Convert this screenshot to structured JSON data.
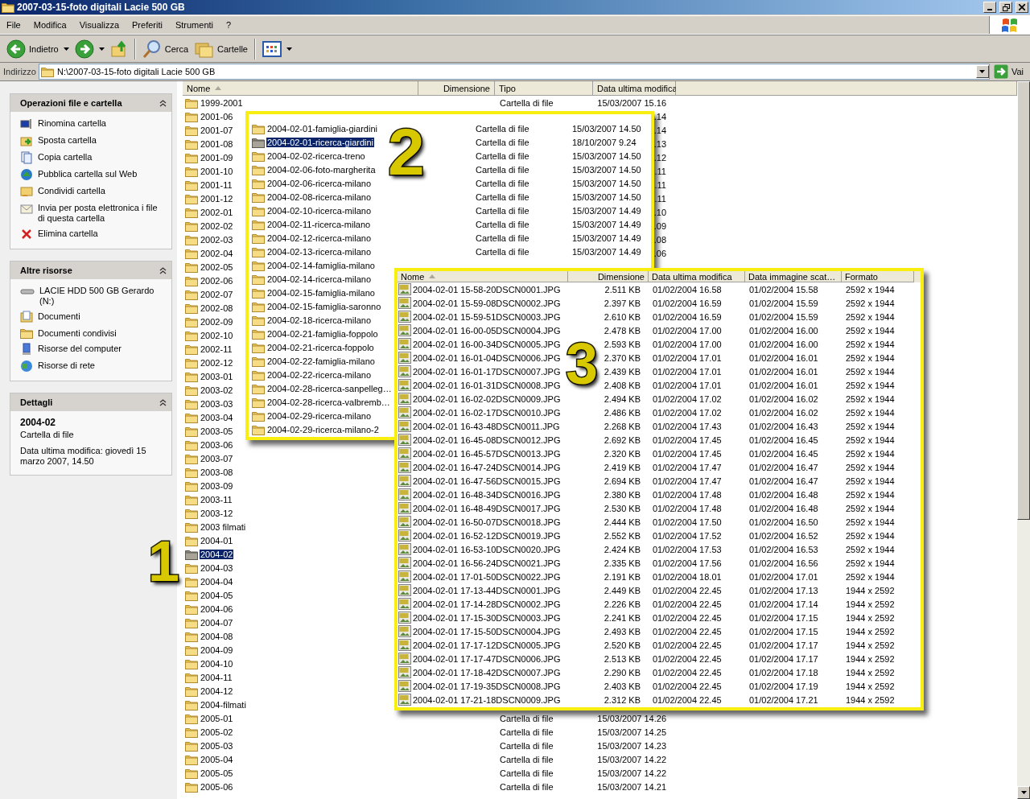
{
  "window": {
    "title": "2007-03-15-foto digitali Lacie 500 GB"
  },
  "menu": [
    "File",
    "Modifica",
    "Visualizza",
    "Preferiti",
    "Strumenti",
    "?"
  ],
  "toolbar": {
    "back": "Indietro",
    "search": "Cerca",
    "folders": "Cartelle"
  },
  "address": {
    "label": "Indirizzo",
    "value": "N:\\2007-03-15-foto digitali Lacie 500 GB",
    "go": "Vai"
  },
  "task_pane": [
    {
      "title": "Operazioni file e cartella",
      "expanded": true,
      "kind": "links",
      "items": [
        "Rinomina cartella",
        "Sposta cartella",
        "Copia cartella",
        "Pubblica cartella sul Web",
        "Condividi cartella",
        "Invia per posta elettronica i file di questa cartella",
        "Elimina cartella"
      ]
    },
    {
      "title": "Altre risorse",
      "expanded": true,
      "kind": "links",
      "items": [
        "LACIE HDD 500 GB Gerardo (N:)",
        "Documenti",
        "Documenti condivisi",
        "Risorse del computer",
        "Risorse di rete"
      ]
    },
    {
      "title": "Dettagli",
      "expanded": true,
      "kind": "details",
      "items": [
        "2004-02",
        "Cartella di file",
        "Data ultima modifica: giovedì 15 marzo 2007, 14.50"
      ]
    }
  ],
  "file_list": {
    "columns": [
      {
        "label": "Nome",
        "sorted": true
      },
      {
        "label": "Dimensione"
      },
      {
        "label": "Tipo"
      },
      {
        "label": "Data ultima modifica"
      }
    ],
    "rows": [
      {
        "name": "1999-2001",
        "type": "Cartella di file",
        "modified": "15/03/2007 15.16",
        "selected": false
      },
      {
        "name": "2001-06",
        "modified": ".14",
        "selected": false
      },
      {
        "name": "2001-07",
        "modified": ".14",
        "selected": false
      },
      {
        "name": "2001-08",
        "modified": ".13",
        "selected": false
      },
      {
        "name": "2001-09",
        "modified": ".12",
        "selected": false
      },
      {
        "name": "2001-10",
        "modified": ".11",
        "selected": false
      },
      {
        "name": "2001-11",
        "modified": ".11",
        "selected": false
      },
      {
        "name": "2001-12",
        "modified": ".11",
        "selected": false
      },
      {
        "name": "2002-01",
        "modified": ".10",
        "selected": false
      },
      {
        "name": "2002-02",
        "modified": ".09",
        "selected": false
      },
      {
        "name": "2002-03",
        "modified": ".08",
        "selected": false
      },
      {
        "name": "2002-04",
        "modified": ".06",
        "selected": false
      },
      {
        "name": "2002-05",
        "selected": false
      },
      {
        "name": "2002-06",
        "selected": false
      },
      {
        "name": "2002-07",
        "selected": false
      },
      {
        "name": "2002-08",
        "selected": false
      },
      {
        "name": "2002-09",
        "selected": false
      },
      {
        "name": "2002-10",
        "selected": false
      },
      {
        "name": "2002-11",
        "selected": false
      },
      {
        "name": "2002-12",
        "selected": false
      },
      {
        "name": "2003-01",
        "selected": false
      },
      {
        "name": "2003-02",
        "selected": false
      },
      {
        "name": "2003-03",
        "selected": false
      },
      {
        "name": "2003-04",
        "selected": false
      },
      {
        "name": "2003-05",
        "selected": false
      },
      {
        "name": "2003-06",
        "selected": false
      },
      {
        "name": "2003-07",
        "selected": false
      },
      {
        "name": "2003-08",
        "selected": false
      },
      {
        "name": "2003-09",
        "selected": false
      },
      {
        "name": "2003-11",
        "selected": false
      },
      {
        "name": "2003-12",
        "selected": false
      },
      {
        "name": "2003 filmati",
        "selected": false
      },
      {
        "name": "2004-01",
        "selected": false
      },
      {
        "name": "2004-02",
        "selected": true
      },
      {
        "name": "2004-03",
        "selected": false
      },
      {
        "name": "2004-04",
        "selected": false
      },
      {
        "name": "2004-05",
        "selected": false
      },
      {
        "name": "2004-06",
        "selected": false
      },
      {
        "name": "2004-07",
        "selected": false
      },
      {
        "name": "2004-08",
        "selected": false
      },
      {
        "name": "2004-09",
        "selected": false
      },
      {
        "name": "2004-10",
        "selected": false
      },
      {
        "name": "2004-11",
        "selected": false
      },
      {
        "name": "2004-12",
        "selected": false
      },
      {
        "name": "2004-filmati",
        "selected": false
      },
      {
        "name": "2005-01",
        "type": "Cartella di file",
        "modified": "15/03/2007 14.26",
        "selected": false
      },
      {
        "name": "2005-02",
        "type": "Cartella di file",
        "modified": "15/03/2007 14.25",
        "selected": false
      },
      {
        "name": "2005-03",
        "type": "Cartella di file",
        "modified": "15/03/2007 14.23",
        "selected": false
      },
      {
        "name": "2005-04",
        "type": "Cartella di file",
        "modified": "15/03/2007 14.22",
        "selected": false
      },
      {
        "name": "2005-05",
        "type": "Cartella di file",
        "modified": "15/03/2007 14.22",
        "selected": false
      },
      {
        "name": "2005-06",
        "type": "Cartella di file",
        "modified": "15/03/2007 14.21",
        "selected": false
      }
    ]
  },
  "subfolder_popup": {
    "rows": [
      {
        "name": "2004-02-01-famiglia-giardini",
        "type": "Cartella di file",
        "modified": "15/03/2007 14.50",
        "selected": false
      },
      {
        "name": "2004-02-01-ricerca-giardini",
        "type": "Cartella di file",
        "modified": "18/10/2007 9.24",
        "selected": true
      },
      {
        "name": "2004-02-02-ricerca-treno",
        "type": "Cartella di file",
        "modified": "15/03/2007 14.50",
        "selected": false
      },
      {
        "name": "2004-02-06-foto-margherita",
        "type": "Cartella di file",
        "modified": "15/03/2007 14.50",
        "selected": false
      },
      {
        "name": "2004-02-06-ricerca-milano",
        "type": "Cartella di file",
        "modified": "15/03/2007 14.50",
        "selected": false
      },
      {
        "name": "2004-02-08-ricerca-milano",
        "type": "Cartella di file",
        "modified": "15/03/2007 14.50",
        "selected": false
      },
      {
        "name": "2004-02-10-ricerca-milano",
        "type": "Cartella di file",
        "modified": "15/03/2007 14.49",
        "selected": false
      },
      {
        "name": "2004-02-11-ricerca-milano",
        "type": "Cartella di file",
        "modified": "15/03/2007 14.49",
        "selected": false
      },
      {
        "name": "2004-02-12-ricerca-milano",
        "type": "Cartella di file",
        "modified": "15/03/2007 14.49",
        "selected": false
      },
      {
        "name": "2004-02-13-ricerca-milano",
        "type": "Cartella di file",
        "modified": "15/03/2007 14.49",
        "selected": false
      },
      {
        "name": "2004-02-14-famiglia-milano",
        "selected": false
      },
      {
        "name": "2004-02-14-ricerca-milano",
        "selected": false
      },
      {
        "name": "2004-02-15-famiglia-milano",
        "selected": false
      },
      {
        "name": "2004-02-15-famiglia-saronno",
        "selected": false
      },
      {
        "name": "2004-02-18-ricerca-milano",
        "selected": false
      },
      {
        "name": "2004-02-21-famiglia-foppolo",
        "selected": false
      },
      {
        "name": "2004-02-21-ricerca-foppolo",
        "selected": false
      },
      {
        "name": "2004-02-22-famiglia-milano",
        "selected": false
      },
      {
        "name": "2004-02-22-ricerca-milano",
        "selected": false
      },
      {
        "name": "2004-02-28-ricerca-sanpelleg…",
        "selected": false
      },
      {
        "name": "2004-02-28-ricerca-valbremb…",
        "selected": false
      },
      {
        "name": "2004-02-29-ricerca-milano",
        "selected": false
      },
      {
        "name": "2004-02-29-ricerca-milano-2",
        "selected": false
      }
    ]
  },
  "photo_popup": {
    "columns": [
      {
        "label": "Nome",
        "sorted": true
      },
      {
        "label": "Dimensione"
      },
      {
        "label": "Data ultima modifica"
      },
      {
        "label": "Data immagine scat…"
      },
      {
        "label": "Formato"
      }
    ],
    "rows": [
      [
        "2004-02-01 15-58-20DSCN0001.JPG",
        "2.511 KB",
        "01/02/2004 16.58",
        "01/02/2004 15.58",
        "2592 x 1944"
      ],
      [
        "2004-02-01 15-59-08DSCN0002.JPG",
        "2.397 KB",
        "01/02/2004 16.59",
        "01/02/2004 15.59",
        "2592 x 1944"
      ],
      [
        "2004-02-01 15-59-51DSCN0003.JPG",
        "2.610 KB",
        "01/02/2004 16.59",
        "01/02/2004 15.59",
        "2592 x 1944"
      ],
      [
        "2004-02-01 16-00-05DSCN0004.JPG",
        "2.478 KB",
        "01/02/2004 17.00",
        "01/02/2004 16.00",
        "2592 x 1944"
      ],
      [
        "2004-02-01 16-00-34DSCN0005.JPG",
        "2.593 KB",
        "01/02/2004 17.00",
        "01/02/2004 16.00",
        "2592 x 1944"
      ],
      [
        "2004-02-01 16-01-04DSCN0006.JPG",
        "2.370 KB",
        "01/02/2004 17.01",
        "01/02/2004 16.01",
        "2592 x 1944"
      ],
      [
        "2004-02-01 16-01-17DSCN0007.JPG",
        "2.439 KB",
        "01/02/2004 17.01",
        "01/02/2004 16.01",
        "2592 x 1944"
      ],
      [
        "2004-02-01 16-01-31DSCN0008.JPG",
        "2.408 KB",
        "01/02/2004 17.01",
        "01/02/2004 16.01",
        "2592 x 1944"
      ],
      [
        "2004-02-01 16-02-02DSCN0009.JPG",
        "2.494 KB",
        "01/02/2004 17.02",
        "01/02/2004 16.02",
        "2592 x 1944"
      ],
      [
        "2004-02-01 16-02-17DSCN0010.JPG",
        "2.486 KB",
        "01/02/2004 17.02",
        "01/02/2004 16.02",
        "2592 x 1944"
      ],
      [
        "2004-02-01 16-43-48DSCN0011.JPG",
        "2.268 KB",
        "01/02/2004 17.43",
        "01/02/2004 16.43",
        "2592 x 1944"
      ],
      [
        "2004-02-01 16-45-08DSCN0012.JPG",
        "2.692 KB",
        "01/02/2004 17.45",
        "01/02/2004 16.45",
        "2592 x 1944"
      ],
      [
        "2004-02-01 16-45-57DSCN0013.JPG",
        "2.320 KB",
        "01/02/2004 17.45",
        "01/02/2004 16.45",
        "2592 x 1944"
      ],
      [
        "2004-02-01 16-47-24DSCN0014.JPG",
        "2.419 KB",
        "01/02/2004 17.47",
        "01/02/2004 16.47",
        "2592 x 1944"
      ],
      [
        "2004-02-01 16-47-56DSCN0015.JPG",
        "2.694 KB",
        "01/02/2004 17.47",
        "01/02/2004 16.47",
        "2592 x 1944"
      ],
      [
        "2004-02-01 16-48-34DSCN0016.JPG",
        "2.380 KB",
        "01/02/2004 17.48",
        "01/02/2004 16.48",
        "2592 x 1944"
      ],
      [
        "2004-02-01 16-48-49DSCN0017.JPG",
        "2.530 KB",
        "01/02/2004 17.48",
        "01/02/2004 16.48",
        "2592 x 1944"
      ],
      [
        "2004-02-01 16-50-07DSCN0018.JPG",
        "2.444 KB",
        "01/02/2004 17.50",
        "01/02/2004 16.50",
        "2592 x 1944"
      ],
      [
        "2004-02-01 16-52-12DSCN0019.JPG",
        "2.552 KB",
        "01/02/2004 17.52",
        "01/02/2004 16.52",
        "2592 x 1944"
      ],
      [
        "2004-02-01 16-53-10DSCN0020.JPG",
        "2.424 KB",
        "01/02/2004 17.53",
        "01/02/2004 16.53",
        "2592 x 1944"
      ],
      [
        "2004-02-01 16-56-24DSCN0021.JPG",
        "2.335 KB",
        "01/02/2004 17.56",
        "01/02/2004 16.56",
        "2592 x 1944"
      ],
      [
        "2004-02-01 17-01-50DSCN0022.JPG",
        "2.191 KB",
        "01/02/2004 18.01",
        "01/02/2004 17.01",
        "2592 x 1944"
      ],
      [
        "2004-02-01 17-13-44DSCN0001.JPG",
        "2.449 KB",
        "01/02/2004 22.45",
        "01/02/2004 17.13",
        "1944 x 2592"
      ],
      [
        "2004-02-01 17-14-28DSCN0002.JPG",
        "2.226 KB",
        "01/02/2004 22.45",
        "01/02/2004 17.14",
        "1944 x 2592"
      ],
      [
        "2004-02-01 17-15-30DSCN0003.JPG",
        "2.241 KB",
        "01/02/2004 22.45",
        "01/02/2004 17.15",
        "1944 x 2592"
      ],
      [
        "2004-02-01 17-15-50DSCN0004.JPG",
        "2.493 KB",
        "01/02/2004 22.45",
        "01/02/2004 17.15",
        "1944 x 2592"
      ],
      [
        "2004-02-01 17-17-12DSCN0005.JPG",
        "2.520 KB",
        "01/02/2004 22.45",
        "01/02/2004 17.17",
        "1944 x 2592"
      ],
      [
        "2004-02-01 17-17-47DSCN0006.JPG",
        "2.513 KB",
        "01/02/2004 22.45",
        "01/02/2004 17.17",
        "1944 x 2592"
      ],
      [
        "2004-02-01 17-18-42DSCN0007.JPG",
        "2.290 KB",
        "01/02/2004 22.45",
        "01/02/2004 17.18",
        "1944 x 2592"
      ],
      [
        "2004-02-01 17-19-35DSCN0008.JPG",
        "2.403 KB",
        "01/02/2004 22.45",
        "01/02/2004 17.19",
        "1944 x 2592"
      ],
      [
        "2004-02-01 17-21-18DSCN0009.JPG",
        "2.312 KB",
        "01/02/2004 22.45",
        "01/02/2004 17.21",
        "1944 x 2592"
      ]
    ]
  },
  "callouts": [
    "1",
    "2",
    "3"
  ]
}
